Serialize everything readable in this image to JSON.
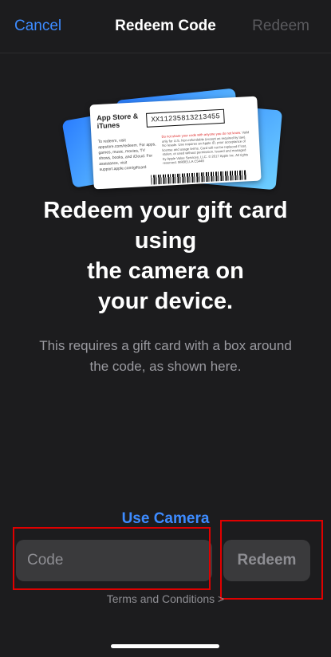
{
  "navbar": {
    "cancel_label": "Cancel",
    "title": "Redeem Code",
    "redeem_label": "Redeem"
  },
  "card_illustration": {
    "brand": "App Store & iTunes",
    "code": "XX11235813213455",
    "redeem_text": "To redeem, visit appstore.com/redeem. For apps, games, music, movies, TV shows, books, and iCloud. For assistance, visit support.apple.com/giftcard",
    "fine_print_warning": "Do not share your code with anyone you do not know.",
    "fine_print": "Valid only for U.S. Non-refundable (except as required by law). No resale. Use requires an Apple ID, prior acceptance of license and usage terms. Card will not be replaced if lost, stolen, or used without permission. Issued and managed by Apple Value Services, LLC. © 2017 Apple Inc. All rights reserved.",
    "serial": "MRBELLA C5448"
  },
  "headline": "Redeem your gift card\nusing\nthe camera on\nyour device.",
  "subtext": "This requires a gift card with a box around the code, as shown here.",
  "use_camera_label": "Use Camera",
  "code_input": {
    "placeholder": "Code",
    "value": ""
  },
  "redeem_button_label": "Redeem",
  "terms_label": "Terms and Conditions >",
  "colors": {
    "accent": "#3d8bff",
    "background": "#1c1c1e",
    "field_bg": "#3a3a3c",
    "highlight": "#e00000"
  }
}
